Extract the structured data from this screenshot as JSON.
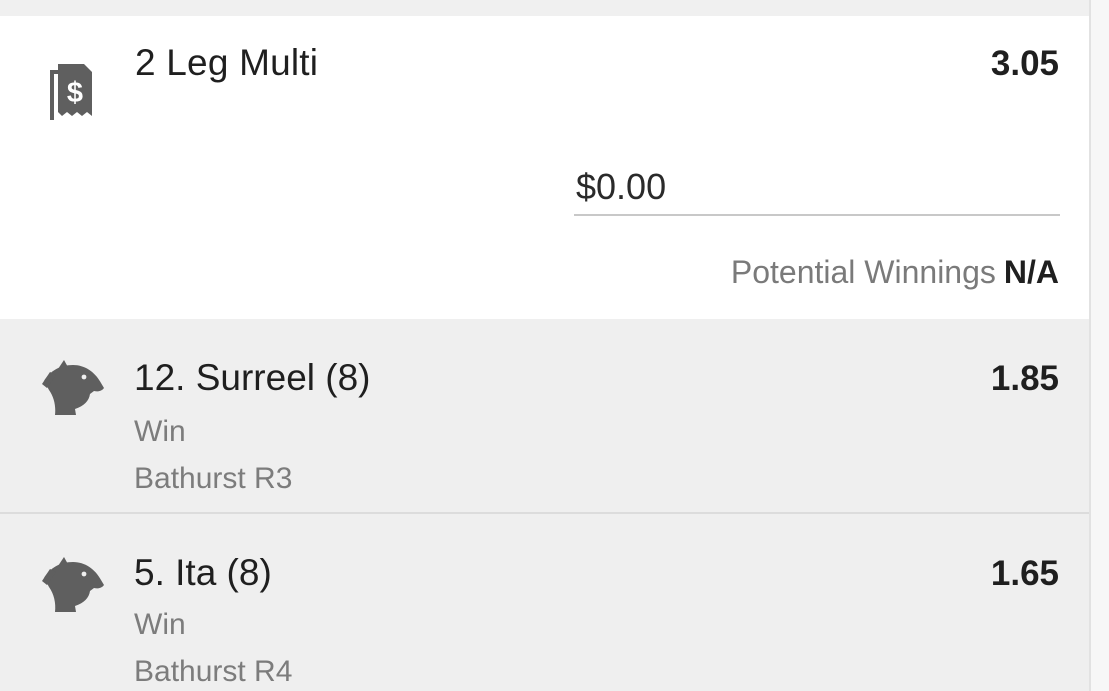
{
  "multi": {
    "title": "2 Leg Multi",
    "odds": "3.05",
    "stake_value": "$0.00",
    "potential_winnings_label": "Potential Winnings",
    "potential_winnings_value": "N/A",
    "icon": "bet-slip-dollar-icon"
  },
  "legs": [
    {
      "name": "12. Surreel (8)",
      "bet_type": "Win",
      "venue": "Bathurst R3",
      "odds": "1.85",
      "icon": "horse-head-icon"
    },
    {
      "name": "5. Ita (8)",
      "bet_type": "Win",
      "venue": "Bathurst R4",
      "odds": "1.65",
      "icon": "horse-head-icon"
    }
  ],
  "colors": {
    "card_background": "#ffffff",
    "leg_background": "#efefef",
    "secondary_text": "#7c7c7c",
    "icon_gray": "#5f5f5f"
  }
}
